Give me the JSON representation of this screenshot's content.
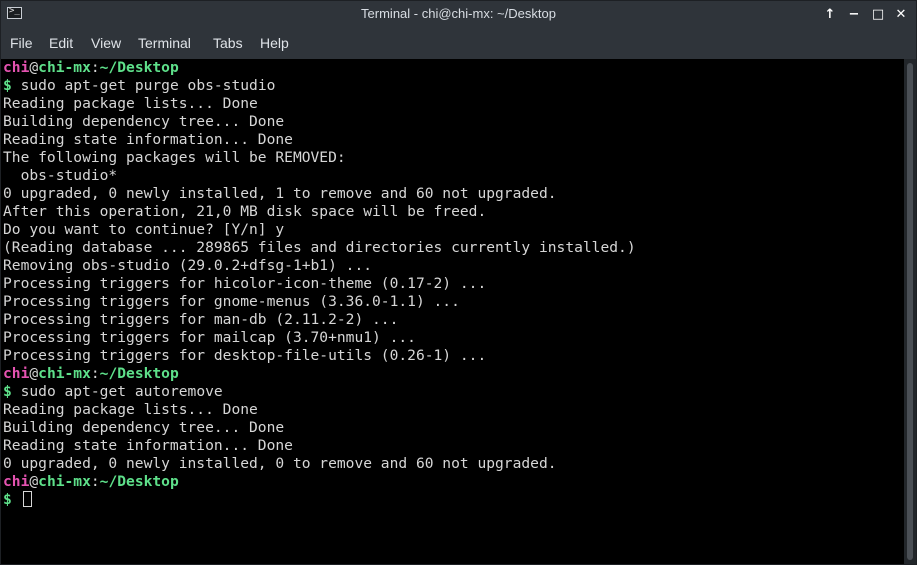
{
  "window": {
    "title": "Terminal - chi@chi-mx: ~/Desktop",
    "app_icon_glyph": ">_",
    "buttons": {
      "up": "↑",
      "minimize": "−",
      "maximize": "□",
      "close": "✕"
    }
  },
  "menu": [
    "File",
    "Edit",
    "View",
    "Terminal",
    "Tabs",
    "Help"
  ],
  "prompt": {
    "user": "chi",
    "at": "@",
    "host": "chi-mx",
    "colon": ":",
    "path": "~/Desktop",
    "symbol": "$"
  },
  "lines": [
    "sudo apt-get purge obs-studio",
    "Reading package lists... Done",
    "Building dependency tree... Done",
    "Reading state information... Done",
    "The following packages will be REMOVED:",
    "  obs-studio*",
    "0 upgraded, 0 newly installed, 1 to remove and 60 not upgraded.",
    "After this operation, 21,0 MB disk space will be freed.",
    "Do you want to continue? [Y/n] y",
    "(Reading database ... 289865 files and directories currently installed.)",
    "Removing obs-studio (29.0.2+dfsg-1+b1) ...",
    "Processing triggers for hicolor-icon-theme (0.17-2) ...",
    "Processing triggers for gnome-menus (3.36.0-1.1) ...",
    "Processing triggers for man-db (2.11.2-2) ...",
    "Processing triggers for mailcap (3.70+nmu1) ...",
    "Processing triggers for desktop-file-utils (0.26-1) ...",
    "sudo apt-get autoremove",
    "Reading package lists... Done",
    "Building dependency tree... Done",
    "Reading state information... Done",
    "0 upgraded, 0 newly installed, 0 to remove and 60 not upgraded."
  ],
  "colors": {
    "user": "#e553b1",
    "host_path": "#5ee08a",
    "text": "#d6d6d6",
    "background": "#000000",
    "chrome": "#2f343a"
  }
}
